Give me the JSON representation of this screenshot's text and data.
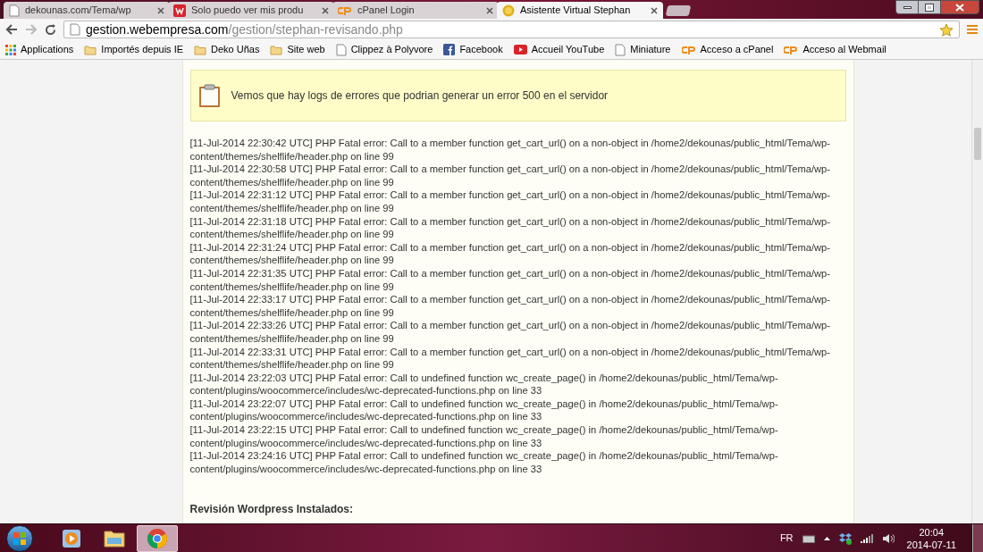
{
  "tabs": [
    {
      "title": "dekounas.com/Tema/wp",
      "kind": "page",
      "selected": false
    },
    {
      "title": "Solo puedo ver mis produ",
      "kind": "w",
      "selected": false
    },
    {
      "title": "cPanel Login",
      "kind": "cpanel",
      "selected": false
    },
    {
      "title": "Asistente Virtual Stephan",
      "kind": "coin",
      "selected": true
    }
  ],
  "address": {
    "host": "gestion.webempresa.com",
    "path": "/gestion/stephan-revisando.php"
  },
  "bookmarks": [
    {
      "label": "Applications",
      "kind": "apps"
    },
    {
      "label": "Importés depuis IE",
      "kind": "folder"
    },
    {
      "label": "Deko Uñas",
      "kind": "folder"
    },
    {
      "label": "Site web",
      "kind": "folder"
    },
    {
      "label": "Clippez à Polyvore",
      "kind": "page"
    },
    {
      "label": "Facebook",
      "kind": "facebook"
    },
    {
      "label": "Accueil YouTube",
      "kind": "youtube"
    },
    {
      "label": "Miniature",
      "kind": "page"
    },
    {
      "label": "Acceso a cPanel",
      "kind": "cpanel"
    },
    {
      "label": "Acceso al Webmail",
      "kind": "cpanel"
    }
  ],
  "alert": {
    "message": "Vemos que hay logs de errores que podrian generar un error 500 en el servidor"
  },
  "log_entries": [
    {
      "lines": [
        "[11-Jul-2014 22:30:42 UTC] PHP Fatal error: Call to a member function get_cart_url() on a non-object in /home2/dekounas/public_html/Tema/wp-",
        "content/themes/shelflife/header.php on line 99"
      ]
    },
    {
      "lines": [
        "[11-Jul-2014 22:30:58 UTC] PHP Fatal error: Call to a member function get_cart_url() on a non-object in /home2/dekounas/public_html/Tema/wp-",
        "content/themes/shelflife/header.php on line 99"
      ]
    },
    {
      "lines": [
        "[11-Jul-2014 22:31:12 UTC] PHP Fatal error: Call to a member function get_cart_url() on a non-object in /home2/dekounas/public_html/Tema/wp-",
        "content/themes/shelflife/header.php on line 99"
      ]
    },
    {
      "lines": [
        "[11-Jul-2014 22:31:18 UTC] PHP Fatal error: Call to a member function get_cart_url() on a non-object in /home2/dekounas/public_html/Tema/wp-",
        "content/themes/shelflife/header.php on line 99"
      ]
    },
    {
      "lines": [
        "[11-Jul-2014 22:31:24 UTC] PHP Fatal error: Call to a member function get_cart_url() on a non-object in /home2/dekounas/public_html/Tema/wp-",
        "content/themes/shelflife/header.php on line 99"
      ]
    },
    {
      "lines": [
        "[11-Jul-2014 22:31:35 UTC] PHP Fatal error: Call to a member function get_cart_url() on a non-object in /home2/dekounas/public_html/Tema/wp-",
        "content/themes/shelflife/header.php on line 99"
      ]
    },
    {
      "lines": [
        "[11-Jul-2014 22:33:17 UTC] PHP Fatal error: Call to a member function get_cart_url() on a non-object in /home2/dekounas/public_html/Tema/wp-",
        "content/themes/shelflife/header.php on line 99"
      ]
    },
    {
      "lines": [
        "[11-Jul-2014 22:33:26 UTC] PHP Fatal error: Call to a member function get_cart_url() on a non-object in /home2/dekounas/public_html/Tema/wp-",
        "content/themes/shelflife/header.php on line 99"
      ]
    },
    {
      "lines": [
        "[11-Jul-2014 22:33:31 UTC] PHP Fatal error: Call to a member function get_cart_url() on a non-object in /home2/dekounas/public_html/Tema/wp-",
        "content/themes/shelflife/header.php on line 99"
      ]
    },
    {
      "lines": [
        "[11-Jul-2014 23:22:03 UTC] PHP Fatal error: Call to undefined function wc_create_page() in /home2/dekounas/public_html/Tema/wp-",
        "content/plugins/woocommerce/includes/wc-deprecated-functions.php on line 33"
      ]
    },
    {
      "lines": [
        "[11-Jul-2014 23:22:07 UTC] PHP Fatal error: Call to undefined function wc_create_page() in /home2/dekounas/public_html/Tema/wp-",
        "content/plugins/woocommerce/includes/wc-deprecated-functions.php on line 33"
      ]
    },
    {
      "lines": [
        "[11-Jul-2014 23:22:15 UTC] PHP Fatal error: Call to undefined function wc_create_page() in /home2/dekounas/public_html/Tema/wp-",
        "content/plugins/woocommerce/includes/wc-deprecated-functions.php on line 33"
      ]
    },
    {
      "lines": [
        "[11-Jul-2014 23:24:16 UTC] PHP Fatal error: Call to undefined function wc_create_page() in /home2/dekounas/public_html/Tema/wp-",
        "content/plugins/woocommerce/includes/wc-deprecated-functions.php on line 33"
      ]
    }
  ],
  "section_heading": "Revisión Wordpress Instalados:",
  "taskbar": {
    "apps": [
      {
        "kind": "media",
        "selected": false
      },
      {
        "kind": "explorer",
        "selected": false
      },
      {
        "kind": "chrome",
        "selected": true
      }
    ],
    "language": "FR",
    "time": "20:04",
    "date": "2014-07-11"
  }
}
